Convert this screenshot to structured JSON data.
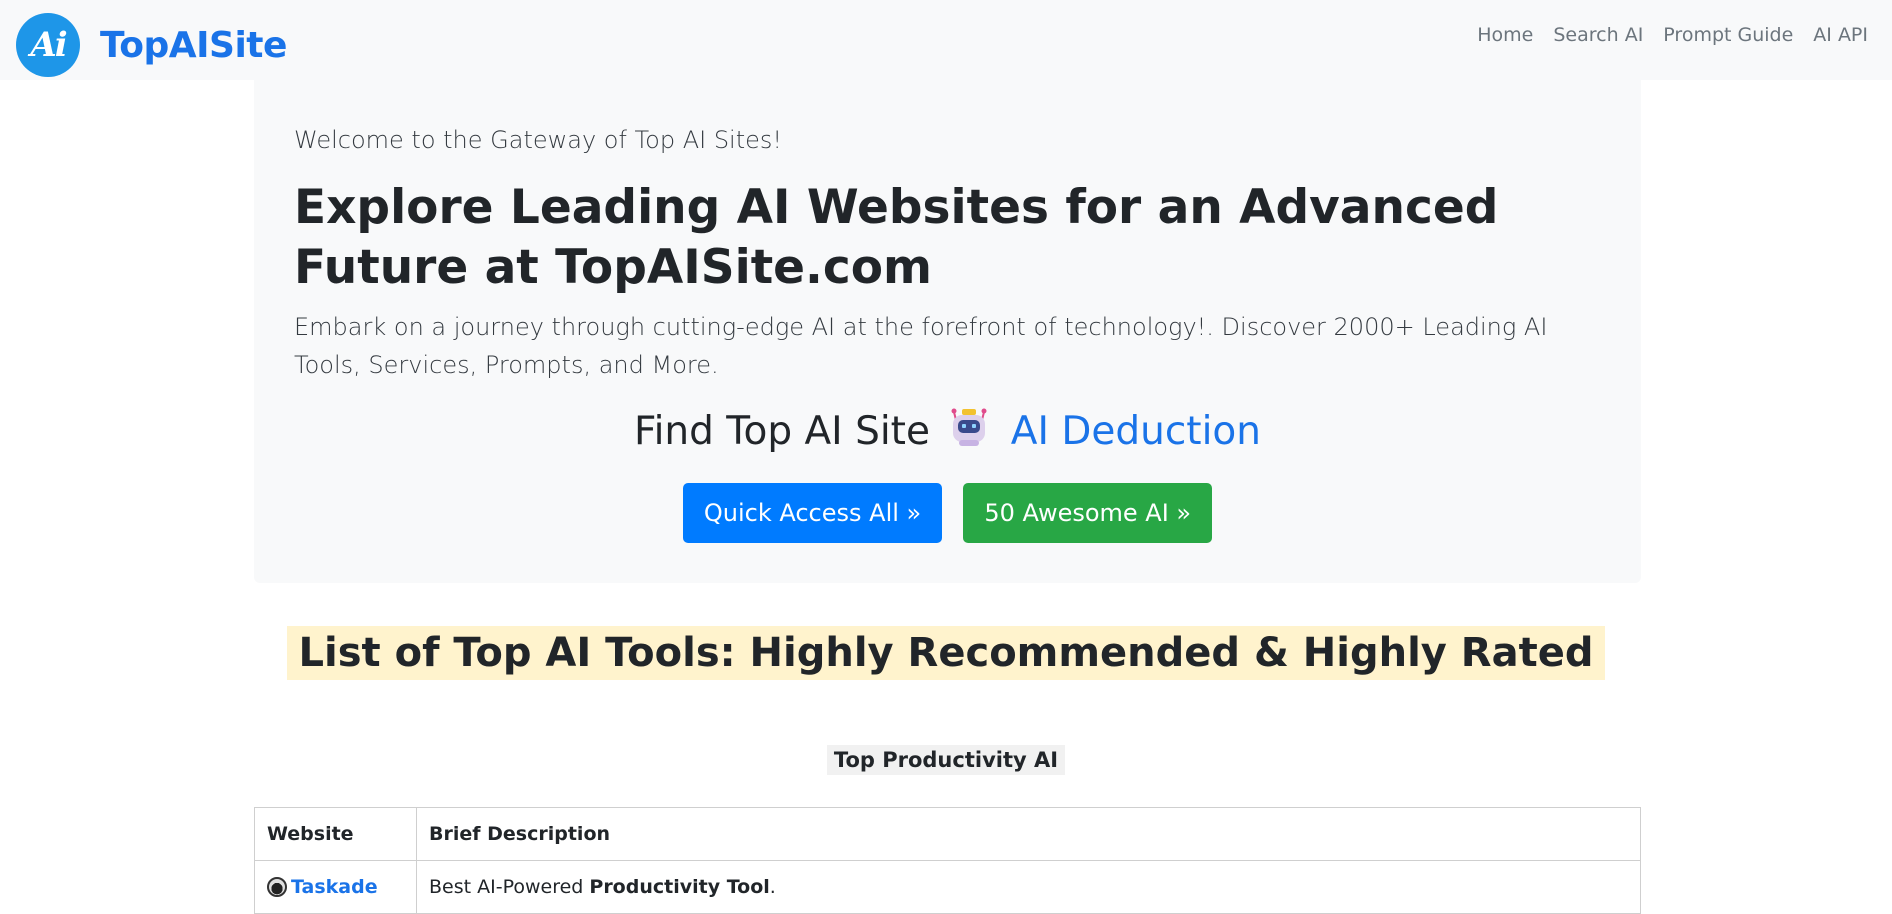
{
  "header": {
    "logo_text": "Ai",
    "brand": "TopAISite",
    "nav": [
      "Home",
      "Search AI",
      "Prompt Guide",
      "AI API"
    ]
  },
  "hero": {
    "welcome": "Welcome to the Gateway of Top AI Sites!",
    "headline": "Explore Leading AI Websites for an Advanced Future at TopAISite.com",
    "lead": "Embark on a journey through cutting-edge AI at the forefront of technology!. Discover 2000+ Leading AI Tools, Services, Prompts, and More.",
    "find_text": "Find Top AI Site",
    "robot_icon": "robot-icon",
    "deduction_link": "AI Deduction",
    "btn_quick": "Quick Access All »",
    "btn_awesome": "50 Awesome AI »"
  },
  "list_title": "List of Top AI Tools: Highly Recommended & Highly Rated",
  "section": {
    "title": "Top Productivity AI",
    "columns": [
      "Website",
      "Brief Description"
    ],
    "rows": [
      {
        "icon": "taskade-icon",
        "name": "Taskade",
        "desc_prefix": "Best AI-Powered ",
        "desc_bold": "Productivity Tool",
        "desc_suffix": "."
      }
    ]
  },
  "colors": {
    "brand_blue": "#1a73e8",
    "primary": "#007bff",
    "success": "#28a745",
    "highlight": "#fff3cd"
  }
}
